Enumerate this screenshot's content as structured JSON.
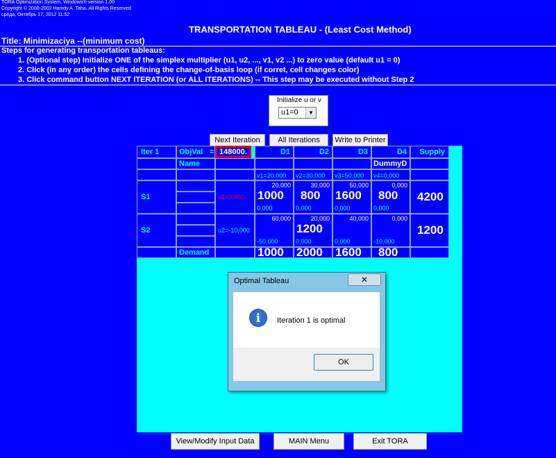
{
  "header": {
    "line1": "TORA Optimization System, Windows®-version 1.00",
    "line2": "Copyright © 2000-2002 Hamdy A. Taha.  All Rights Reserved",
    "line3": "среда, Октябрь 17, 2012 11:52"
  },
  "page_title": "TRANSPORTATION TABLEAU - (Least Cost Method)",
  "title_line": "Title: Minimizaciya --(minimum cost)",
  "steps": {
    "heading": "Steps for generating transportation tableaus:",
    "items": [
      "1.  (Optional step) Initialize ONE of the simplex multiplier (u1, u2, ..., v1, v2 ...) to zero value (default u1 = 0)",
      "2.  Click (in any order) the cells defining the change-of-basis loop (if corret, cell changes color)",
      "3.  Click command button NEXT ITERATION (or ALL ITERATIONS) -- This step may be executed without Step 2"
    ]
  },
  "init": {
    "label": "Initialize u or v",
    "selected": "u1=0"
  },
  "toolbar": {
    "next_iteration": "Next Iteration",
    "all_iterations": "All Iterations",
    "write_to_printer": "Write to Printer"
  },
  "tableau": {
    "iter_label": "Iter 1",
    "objval_label": "ObjVal",
    "objval_eq": "=",
    "objval": "148000.",
    "name_label": "Name",
    "columns": [
      "D1",
      "D2",
      "D3",
      "D4"
    ],
    "dummy_label": "DummyD",
    "supply_label": "Supply",
    "v_values": [
      "v1=20,000",
      "v2=30,000",
      "v3=50,000",
      "v4=0,000"
    ],
    "rows": [
      {
        "name": "S1",
        "u": "u1=0,000",
        "costs": [
          "20,000",
          "30,000",
          "50,000",
          "0,000"
        ],
        "alloc": [
          "1000",
          "800",
          "1600",
          "800"
        ],
        "reduced": [
          "0,000",
          "0,000",
          "0,000",
          "0,000"
        ],
        "supply": "4200"
      },
      {
        "name": "S2",
        "u": "u2=-10,000",
        "costs": [
          "60,000",
          "20,000",
          "40,000",
          "0,000"
        ],
        "alloc": [
          "",
          "1200",
          "",
          ""
        ],
        "reduced": [
          "-50,000",
          "0,000",
          "0,000",
          "-10,000"
        ],
        "supply": "1200"
      }
    ],
    "demand_label": "Demand",
    "demand": [
      "1000",
      "2000",
      "1600",
      "800"
    ]
  },
  "dialog": {
    "title": "Optimal Tableau",
    "close": "✕",
    "icon": "info-icon",
    "message": "Iteration 1 is optimal",
    "ok": "OK"
  },
  "bottom": {
    "view_modify": "View/Modify Input Data",
    "main_menu": "MAIN Menu",
    "exit": "Exit TORA"
  },
  "colors": {
    "background": "#0000ff",
    "panel": "#00ffff",
    "highlight": "#ff0000"
  }
}
